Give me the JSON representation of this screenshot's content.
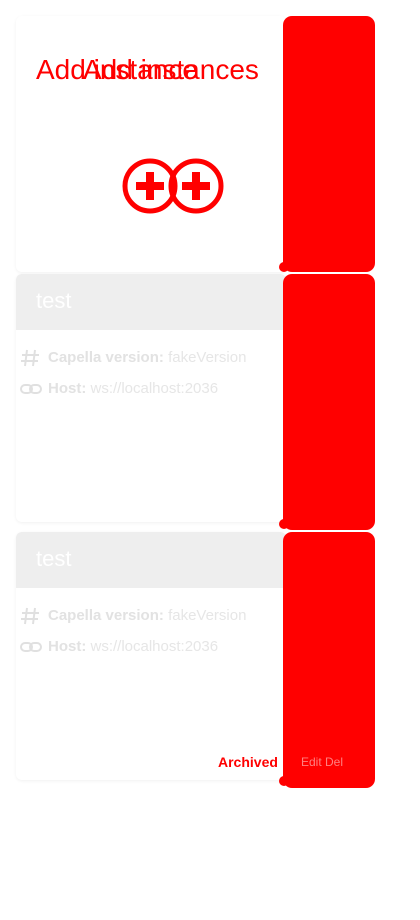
{
  "add_card": {
    "title": "Add instance",
    "title_ghost": "Add instances"
  },
  "instances": [
    {
      "name": "test",
      "version_label": "Capella version:",
      "version_value": "fakeVersion",
      "host_label": "Host:",
      "host_value": "ws://localhost:2036"
    },
    {
      "name": "test",
      "version_label": "Capella version:",
      "version_value": "fakeVersion",
      "host_label": "Host:",
      "host_value": "ws://localhost:2036",
      "archived_label": "Archived",
      "actions_label": "Edit   Del"
    }
  ],
  "colors": {
    "accent": "#ff0000",
    "header_bg": "#eeeeee",
    "muted_text": "#e4e4e4"
  }
}
